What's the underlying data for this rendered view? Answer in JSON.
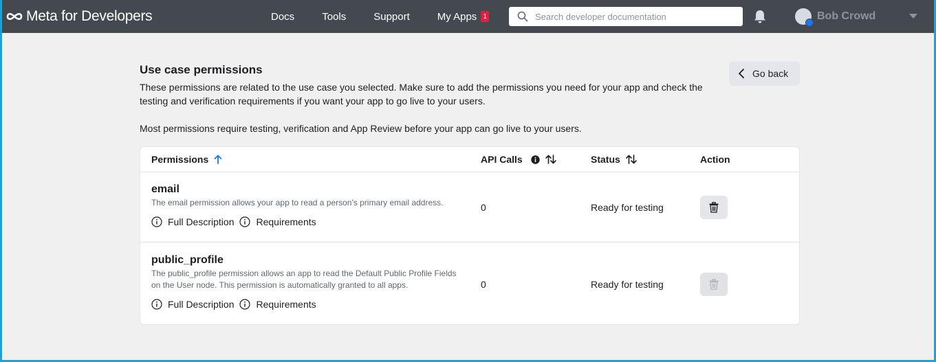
{
  "nav": {
    "brand": "Meta for Developers",
    "links": [
      "Docs",
      "Tools",
      "Support"
    ],
    "my_apps_label": "My Apps",
    "my_apps_badge": "1",
    "search_placeholder": "Search developer documentation",
    "user_name": "Bob Crowd"
  },
  "page": {
    "title": "Use case permissions",
    "description": "These permissions are related to the use case you selected. Make sure to add the permissions you need for your app and check the testing and verification requirements if you want your app to go live to your users.",
    "note": "Most permissions require testing, verification and App Review before your app can go live to your users.",
    "go_back_label": "Go back"
  },
  "table": {
    "headers": {
      "permissions": "Permissions",
      "api_calls": "API Calls",
      "status": "Status",
      "action": "Action"
    },
    "rows": [
      {
        "name": "email",
        "description": "The email permission allows your app to read a person's primary email address.",
        "full_description_label": "Full Description",
        "requirements_label": "Requirements",
        "api_calls": "0",
        "status": "Ready for testing",
        "delete_disabled": false
      },
      {
        "name": "public_profile",
        "description": "The public_profile permission allows an app to read the Default Public Profile Fields on the User node. This permission is automatically granted to all apps.",
        "full_description_label": "Full Description",
        "requirements_label": "Requirements",
        "api_calls": "0",
        "status": "Ready for testing",
        "delete_disabled": true
      }
    ]
  },
  "colors": {
    "nav_bg": "#444950",
    "accent": "#1877f2",
    "badge": "#e41e3f",
    "page_bg": "#f0f0f0"
  }
}
